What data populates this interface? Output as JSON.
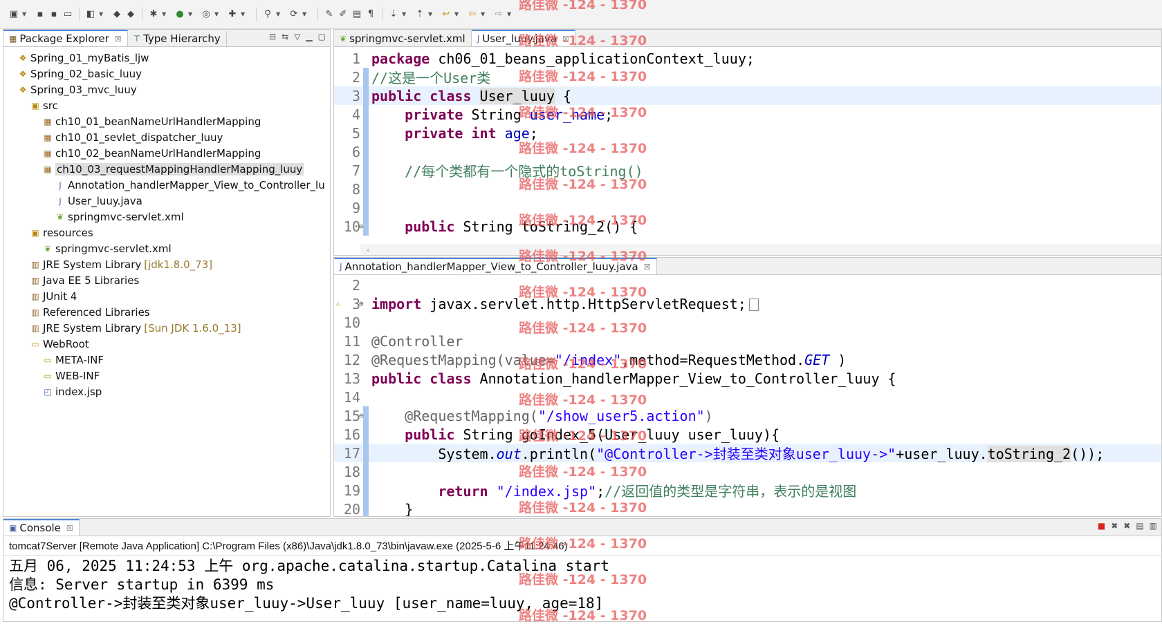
{
  "toolbar": {
    "icons": [
      "new-icon",
      "save-icon",
      "save-all-icon",
      "print-icon",
      "open-type-icon",
      "debug-icon",
      "run-icon",
      "search-icon",
      "refresh-icon",
      "back-icon",
      "forward-icon"
    ]
  },
  "package_explorer": {
    "tabs": [
      {
        "label": "Package Explorer",
        "close": "☒"
      },
      {
        "label": "Type Hierarchy"
      }
    ],
    "items": [
      {
        "label": "Spring_01_myBatis_ljw",
        "indent": 0,
        "icon": "project-icon"
      },
      {
        "label": "Spring_02_basic_luuy",
        "indent": 0,
        "icon": "project-icon"
      },
      {
        "label": "Spring_03_mvc_luuy",
        "indent": 0,
        "icon": "project-icon"
      },
      {
        "label": "src",
        "indent": 1,
        "icon": "source-folder-icon"
      },
      {
        "label": "ch10_01_beanNameUrlHandlerMapping",
        "indent": 2,
        "icon": "package-icon"
      },
      {
        "label": "ch10_01_sevlet_dispatcher_luuy",
        "indent": 2,
        "icon": "package-icon"
      },
      {
        "label": "ch10_02_beanNameUrlHandlerMapping",
        "indent": 2,
        "icon": "package-icon"
      },
      {
        "label": "ch10_03_requestMappingHandlerMapping_luuy",
        "indent": 2,
        "icon": "package-icon",
        "selected": true
      },
      {
        "label": "Annotation_handlerMapper_View_to_Controller_lu",
        "indent": 3,
        "icon": "java-file-icon"
      },
      {
        "label": "User_luuy.java",
        "indent": 3,
        "icon": "java-file-icon"
      },
      {
        "label": "springmvc-servlet.xml",
        "indent": 3,
        "icon": "xml-file-icon"
      },
      {
        "label": "resources",
        "indent": 1,
        "icon": "source-folder-icon"
      },
      {
        "label": "springmvc-servlet.xml",
        "indent": 2,
        "icon": "xml-file-icon"
      },
      {
        "label": "JRE System Library",
        "decor": "[jdk1.8.0_73]",
        "indent": 1,
        "icon": "library-icon"
      },
      {
        "label": "Java EE 5 Libraries",
        "indent": 1,
        "icon": "library-icon"
      },
      {
        "label": "JUnit 4",
        "indent": 1,
        "icon": "library-icon"
      },
      {
        "label": "Referenced Libraries",
        "indent": 1,
        "icon": "library-icon"
      },
      {
        "label": "JRE System Library",
        "decor": "[Sun JDK 1.6.0_13]",
        "indent": 1,
        "icon": "library-icon"
      },
      {
        "label": "WebRoot",
        "indent": 1,
        "icon": "folder-icon"
      },
      {
        "label": "META-INF",
        "indent": 2,
        "icon": "folder-icon"
      },
      {
        "label": "WEB-INF",
        "indent": 2,
        "icon": "folder-icon"
      },
      {
        "label": "index.jsp",
        "indent": 2,
        "icon": "jsp-file-icon"
      }
    ]
  },
  "editor_top": {
    "tabs": [
      {
        "label": "springmvc-servlet.xml"
      },
      {
        "label": "User_luuy.java",
        "close": "☒"
      }
    ],
    "lines": [
      {
        "n": "1"
      },
      {
        "n": "2"
      },
      {
        "n": "3"
      },
      {
        "n": "4"
      },
      {
        "n": "5"
      },
      {
        "n": "6"
      },
      {
        "n": "7"
      },
      {
        "n": "8"
      },
      {
        "n": "9"
      },
      {
        "n": "10"
      }
    ],
    "code": {
      "l1_kw": "package",
      "l1_rest": " ch06_01_beans_applicationContext_luuy;",
      "l2": "//这是一个User类",
      "l3_kw": "public class",
      "l3_name": "User_luuy",
      "l3_rest": " {",
      "l4_kw": "private",
      "l4_type": " String ",
      "l4_field": "user_name",
      "l4_end": ";",
      "l5_kw": "private int",
      "l5_field": "age",
      "l5_end": ";",
      "l7": "//每个类都有一个隐式的toString()",
      "l10_kw": "public",
      "l10_rest": " String toString_2() {"
    }
  },
  "editor_bottom": {
    "tabs": [
      {
        "label": "Annotation_handlerMapper_View_to_Controller_luuy.java",
        "close": "☒"
      }
    ],
    "lines": [
      {
        "n": "2"
      },
      {
        "n": "3"
      },
      {
        "n": "10"
      },
      {
        "n": "11"
      },
      {
        "n": "12"
      },
      {
        "n": "13"
      },
      {
        "n": "14"
      },
      {
        "n": "15"
      },
      {
        "n": "16"
      },
      {
        "n": "17"
      },
      {
        "n": "18"
      },
      {
        "n": "19"
      },
      {
        "n": "20"
      }
    ],
    "code": {
      "l3_kw": "import",
      "l3_rest": " javax.servlet.http.HttpServletRequest;",
      "l11": "@Controller",
      "l12_a": "@RequestMapping(value=",
      "l12_str": "\"/index\"",
      "l12_b": ",method=RequestMethod.",
      "l12_get": "GET",
      "l12_c": " )",
      "l13_kw": "public class",
      "l13_rest": " Annotation_handlerMapper_View_to_Controller_luuy {",
      "l15_a": "@RequestMapping(",
      "l15_str": "\"/show_user5.action\"",
      "l15_b": ")",
      "l16_kw": "public",
      "l16_rest": " String goIndex_5(User_luuy user_luuy){",
      "l17_a": "System.",
      "l17_out": "out",
      "l17_b": ".println(",
      "l17_str": "\"@Controller->封装至类对象user_luuy->\"",
      "l17_c": "+user_luuy.",
      "l17_m": "toString_2",
      "l17_d": "());",
      "l19_kw": "return",
      "l19_str": " \"/index.jsp\"",
      "l19_semi": ";",
      "l19_cm": "//返回值的类型是字符串，表示的是视图",
      "l20": "}"
    }
  },
  "console": {
    "tab_label": "Console",
    "tab_close": "☒",
    "header": "tomcat7Server [Remote Java Application] C:\\Program Files (x86)\\Java\\jdk1.8.0_73\\bin\\javaw.exe (2025-5-6 上午11:24:46)",
    "lines": [
      "五月 06, 2025 11:24:53 上午 org.apache.catalina.startup.Catalina start",
      "信息: Server startup in 6399 ms",
      "@Controller->封装至类对象user_luuy->User_luuy [user_name=luuy, age=18]"
    ]
  },
  "watermark": "路佳微 -124 - 1370"
}
